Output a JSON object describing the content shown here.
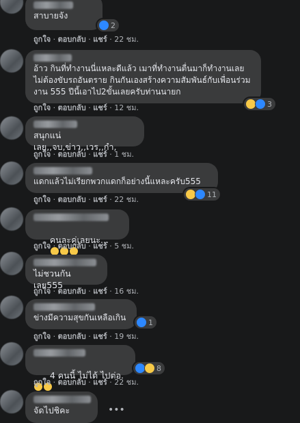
{
  "actions": {
    "like": "ถูกใจ",
    "reply": "ตอบกลับ",
    "share": "แชร์",
    "sep": "·"
  },
  "comments": [
    {
      "text": "สาบายจัง",
      "count": "2",
      "time": "22 ชม."
    },
    {
      "text": "อ้าว กินที่ทำงานนี่แหละดีแล้ว เมาที่ทำงานตื่นมาก็ทำงานเลย\nไม่ต้องขับรถอันตราย กินกันเองสร้างความสัมพันธ์กับเพื่อนร่วม\nงาน 555 ปีนี้เอาไป2ขั้นเลยครับท่านนายก",
      "count": "3",
      "time": "12 ชม."
    },
    {
      "text": "สนุกแน่เลย,,จบ,ข่าว,,เวร,,กำ,",
      "time": "1 ชม."
    },
    {
      "text": "แดกแล้วไม่เรียกพวกแดกก็อย่างนี้แหละครับ555",
      "count": "11",
      "time": "22 ชม."
    },
    {
      "text": "คนละคู่เลยนะ...",
      "time": "5 ชม."
    },
    {
      "text": "ไม่ชวนกันเลย555",
      "time": "16 ชม."
    },
    {
      "text": "ข่างมีความสุขกันเหลือเกิน",
      "count": "1",
      "time": "19 ชม."
    },
    {
      "text": "4 คนนี้ ไม่ได้ ไปต่อ.",
      "count": "8",
      "time": "22 ชม."
    },
    {
      "text": "จัดไปชิคะ"
    }
  ],
  "colors": {
    "like": "#2d88ff",
    "haha": "#f7c948",
    "bubble": "#3a3b3c",
    "bg": "#18191a"
  }
}
